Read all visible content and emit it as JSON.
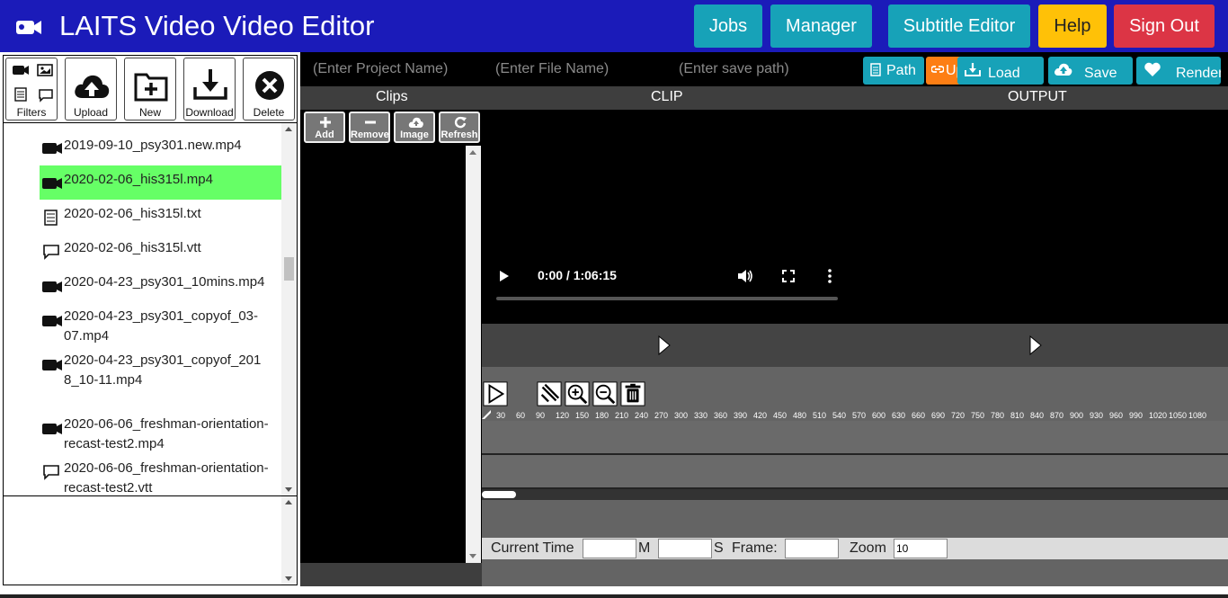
{
  "header": {
    "title": "LAITS Video Video Editor",
    "logo_icon": "video-camera-icon",
    "buttons": [
      {
        "label": "Jobs",
        "color": "#17a2b8"
      },
      {
        "label": "Manager",
        "color": "#17a2b8"
      },
      {
        "label": "Subtitle Editor",
        "color": "#17a2b8"
      },
      {
        "label": "Help",
        "color": "#ffc107"
      },
      {
        "label": "Sign Out",
        "color": "#dc3545"
      }
    ]
  },
  "sidebar": {
    "toolbar": {
      "filters_label": "Filters",
      "upload_label": "Upload",
      "new_label": "New",
      "download_label": "Download",
      "delete_label": "Delete"
    },
    "files": [
      {
        "name": "2019-09-10_psy301.new.mp4",
        "icon": "video-camera-icon",
        "selected": false
      },
      {
        "name": "2020-02-06_his315l.mp4",
        "icon": "video-camera-icon",
        "selected": true
      },
      {
        "name": "2020-02-06_his315l.txt",
        "icon": "text-file-icon",
        "selected": false
      },
      {
        "name": "2020-02-06_his315l.vtt",
        "icon": "speech-bubble-icon",
        "selected": false
      },
      {
        "name": "2020-04-23_psy301_10mins.mp4",
        "icon": "video-camera-icon",
        "selected": false
      },
      {
        "name": "2020-04-23_psy301_copyof_03-07.mp4",
        "icon": "video-camera-icon",
        "selected": false
      },
      {
        "name": "2020-04-23_psy301_copyof_2018_10-11.mp4",
        "icon": "video-camera-icon",
        "selected": false
      },
      {
        "name": "2020-06-06_freshman-orientation-recast-test2.mp4",
        "icon": "video-camera-icon",
        "selected": false
      },
      {
        "name": "2020-06-06_freshman-orientation-recast-test2.vtt",
        "icon": "speech-bubble-icon",
        "selected": false
      }
    ],
    "selected_color": "#66ff66"
  },
  "editor": {
    "project_name_placeholder": "(Enter Project Name)",
    "file_name_placeholder": "(Enter File Name)",
    "save_path_placeholder": "(Enter save path)",
    "buttons": {
      "path_label": "Path",
      "upload_partial_label": "Up",
      "load_label": "Load",
      "save_label": "Save",
      "render_label": "Render"
    },
    "section_labels": {
      "clips": "Clips",
      "clip": "CLIP",
      "output": "OUTPUT"
    },
    "clip_buttons": {
      "add": "Add",
      "remove": "Remove",
      "image": "Image",
      "refresh": "Refresh"
    },
    "video": {
      "time_display": "0:00 / 1:06:15",
      "progress": 0
    },
    "ruler_ticks": [
      "30",
      "60",
      "90",
      "120",
      "150",
      "180",
      "210",
      "240",
      "270",
      "300",
      "330",
      "360",
      "390",
      "420",
      "450",
      "480",
      "510",
      "540",
      "570",
      "600",
      "630",
      "660",
      "690",
      "720",
      "750",
      "780",
      "810",
      "840",
      "870",
      "900",
      "930",
      "960",
      "990",
      "1020",
      "1050",
      "1080"
    ],
    "timebar": {
      "current_time_label": "Current Time",
      "minutes_label": "M",
      "seconds_label": "S",
      "frame_label": "Frame:",
      "zoom_label": "Zoom",
      "zoom_value": "10",
      "minutes_value": "",
      "seconds_value": "",
      "frame_value": ""
    },
    "colors": {
      "accent": "#17a2b8",
      "upload_orange": "#fd7e14"
    }
  }
}
